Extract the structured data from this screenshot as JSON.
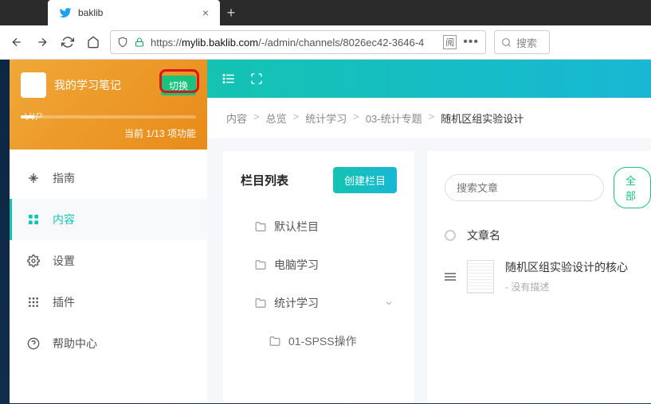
{
  "browser": {
    "tab_title": "baklib",
    "url_prefix": "https://",
    "url_domain": "mylib.baklib.com",
    "url_path": "/-/admin/channels/8026ec42-3646-4",
    "reader_label": "阅",
    "search_placeholder": "搜索"
  },
  "workspace": {
    "title": "我的学习笔记",
    "switch_label": "切换",
    "vip": "VIP",
    "status": "当前 1/13 项功能"
  },
  "sidebar": {
    "items": [
      {
        "label": "指南",
        "icon": "guide"
      },
      {
        "label": "内容",
        "icon": "content",
        "active": true
      },
      {
        "label": "设置",
        "icon": "gear"
      },
      {
        "label": "插件",
        "icon": "apps"
      },
      {
        "label": "帮助中心",
        "icon": "help"
      }
    ]
  },
  "breadcrumb": [
    "内容",
    "总览",
    "统计学习",
    "03-统计专题",
    "随机区组实验设计"
  ],
  "column_panel": {
    "title": "栏目列表",
    "create_label": "创建栏目",
    "folders": [
      {
        "label": "默认栏目"
      },
      {
        "label": "电脑学习"
      },
      {
        "label": "统计学习",
        "expandable": true
      },
      {
        "label": "01-SPSS操作",
        "sub": true
      }
    ]
  },
  "articles": {
    "search_placeholder": "搜索文章",
    "filter_label": "全部",
    "header_label": "文章名",
    "items": [
      {
        "title": "随机区组实验设计的核心",
        "desc": "- 没有描述"
      }
    ]
  }
}
